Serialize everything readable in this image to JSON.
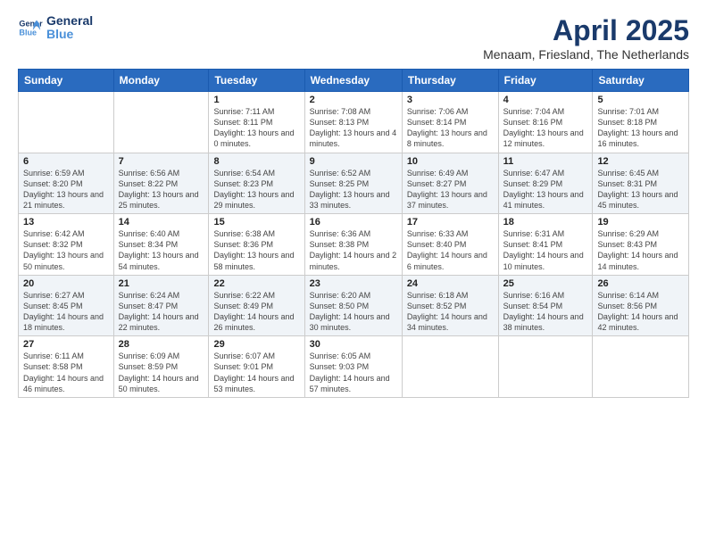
{
  "logo": {
    "line1": "General",
    "line2": "Blue"
  },
  "title": "April 2025",
  "subtitle": "Menaam, Friesland, The Netherlands",
  "weekdays": [
    "Sunday",
    "Monday",
    "Tuesday",
    "Wednesday",
    "Thursday",
    "Friday",
    "Saturday"
  ],
  "weeks": [
    [
      {
        "day": "",
        "info": ""
      },
      {
        "day": "",
        "info": ""
      },
      {
        "day": "1",
        "info": "Sunrise: 7:11 AM\nSunset: 8:11 PM\nDaylight: 13 hours and 0 minutes."
      },
      {
        "day": "2",
        "info": "Sunrise: 7:08 AM\nSunset: 8:13 PM\nDaylight: 13 hours and 4 minutes."
      },
      {
        "day": "3",
        "info": "Sunrise: 7:06 AM\nSunset: 8:14 PM\nDaylight: 13 hours and 8 minutes."
      },
      {
        "day": "4",
        "info": "Sunrise: 7:04 AM\nSunset: 8:16 PM\nDaylight: 13 hours and 12 minutes."
      },
      {
        "day": "5",
        "info": "Sunrise: 7:01 AM\nSunset: 8:18 PM\nDaylight: 13 hours and 16 minutes."
      }
    ],
    [
      {
        "day": "6",
        "info": "Sunrise: 6:59 AM\nSunset: 8:20 PM\nDaylight: 13 hours and 21 minutes."
      },
      {
        "day": "7",
        "info": "Sunrise: 6:56 AM\nSunset: 8:22 PM\nDaylight: 13 hours and 25 minutes."
      },
      {
        "day": "8",
        "info": "Sunrise: 6:54 AM\nSunset: 8:23 PM\nDaylight: 13 hours and 29 minutes."
      },
      {
        "day": "9",
        "info": "Sunrise: 6:52 AM\nSunset: 8:25 PM\nDaylight: 13 hours and 33 minutes."
      },
      {
        "day": "10",
        "info": "Sunrise: 6:49 AM\nSunset: 8:27 PM\nDaylight: 13 hours and 37 minutes."
      },
      {
        "day": "11",
        "info": "Sunrise: 6:47 AM\nSunset: 8:29 PM\nDaylight: 13 hours and 41 minutes."
      },
      {
        "day": "12",
        "info": "Sunrise: 6:45 AM\nSunset: 8:31 PM\nDaylight: 13 hours and 45 minutes."
      }
    ],
    [
      {
        "day": "13",
        "info": "Sunrise: 6:42 AM\nSunset: 8:32 PM\nDaylight: 13 hours and 50 minutes."
      },
      {
        "day": "14",
        "info": "Sunrise: 6:40 AM\nSunset: 8:34 PM\nDaylight: 13 hours and 54 minutes."
      },
      {
        "day": "15",
        "info": "Sunrise: 6:38 AM\nSunset: 8:36 PM\nDaylight: 13 hours and 58 minutes."
      },
      {
        "day": "16",
        "info": "Sunrise: 6:36 AM\nSunset: 8:38 PM\nDaylight: 14 hours and 2 minutes."
      },
      {
        "day": "17",
        "info": "Sunrise: 6:33 AM\nSunset: 8:40 PM\nDaylight: 14 hours and 6 minutes."
      },
      {
        "day": "18",
        "info": "Sunrise: 6:31 AM\nSunset: 8:41 PM\nDaylight: 14 hours and 10 minutes."
      },
      {
        "day": "19",
        "info": "Sunrise: 6:29 AM\nSunset: 8:43 PM\nDaylight: 14 hours and 14 minutes."
      }
    ],
    [
      {
        "day": "20",
        "info": "Sunrise: 6:27 AM\nSunset: 8:45 PM\nDaylight: 14 hours and 18 minutes."
      },
      {
        "day": "21",
        "info": "Sunrise: 6:24 AM\nSunset: 8:47 PM\nDaylight: 14 hours and 22 minutes."
      },
      {
        "day": "22",
        "info": "Sunrise: 6:22 AM\nSunset: 8:49 PM\nDaylight: 14 hours and 26 minutes."
      },
      {
        "day": "23",
        "info": "Sunrise: 6:20 AM\nSunset: 8:50 PM\nDaylight: 14 hours and 30 minutes."
      },
      {
        "day": "24",
        "info": "Sunrise: 6:18 AM\nSunset: 8:52 PM\nDaylight: 14 hours and 34 minutes."
      },
      {
        "day": "25",
        "info": "Sunrise: 6:16 AM\nSunset: 8:54 PM\nDaylight: 14 hours and 38 minutes."
      },
      {
        "day": "26",
        "info": "Sunrise: 6:14 AM\nSunset: 8:56 PM\nDaylight: 14 hours and 42 minutes."
      }
    ],
    [
      {
        "day": "27",
        "info": "Sunrise: 6:11 AM\nSunset: 8:58 PM\nDaylight: 14 hours and 46 minutes."
      },
      {
        "day": "28",
        "info": "Sunrise: 6:09 AM\nSunset: 8:59 PM\nDaylight: 14 hours and 50 minutes."
      },
      {
        "day": "29",
        "info": "Sunrise: 6:07 AM\nSunset: 9:01 PM\nDaylight: 14 hours and 53 minutes."
      },
      {
        "day": "30",
        "info": "Sunrise: 6:05 AM\nSunset: 9:03 PM\nDaylight: 14 hours and 57 minutes."
      },
      {
        "day": "",
        "info": ""
      },
      {
        "day": "",
        "info": ""
      },
      {
        "day": "",
        "info": ""
      }
    ]
  ]
}
